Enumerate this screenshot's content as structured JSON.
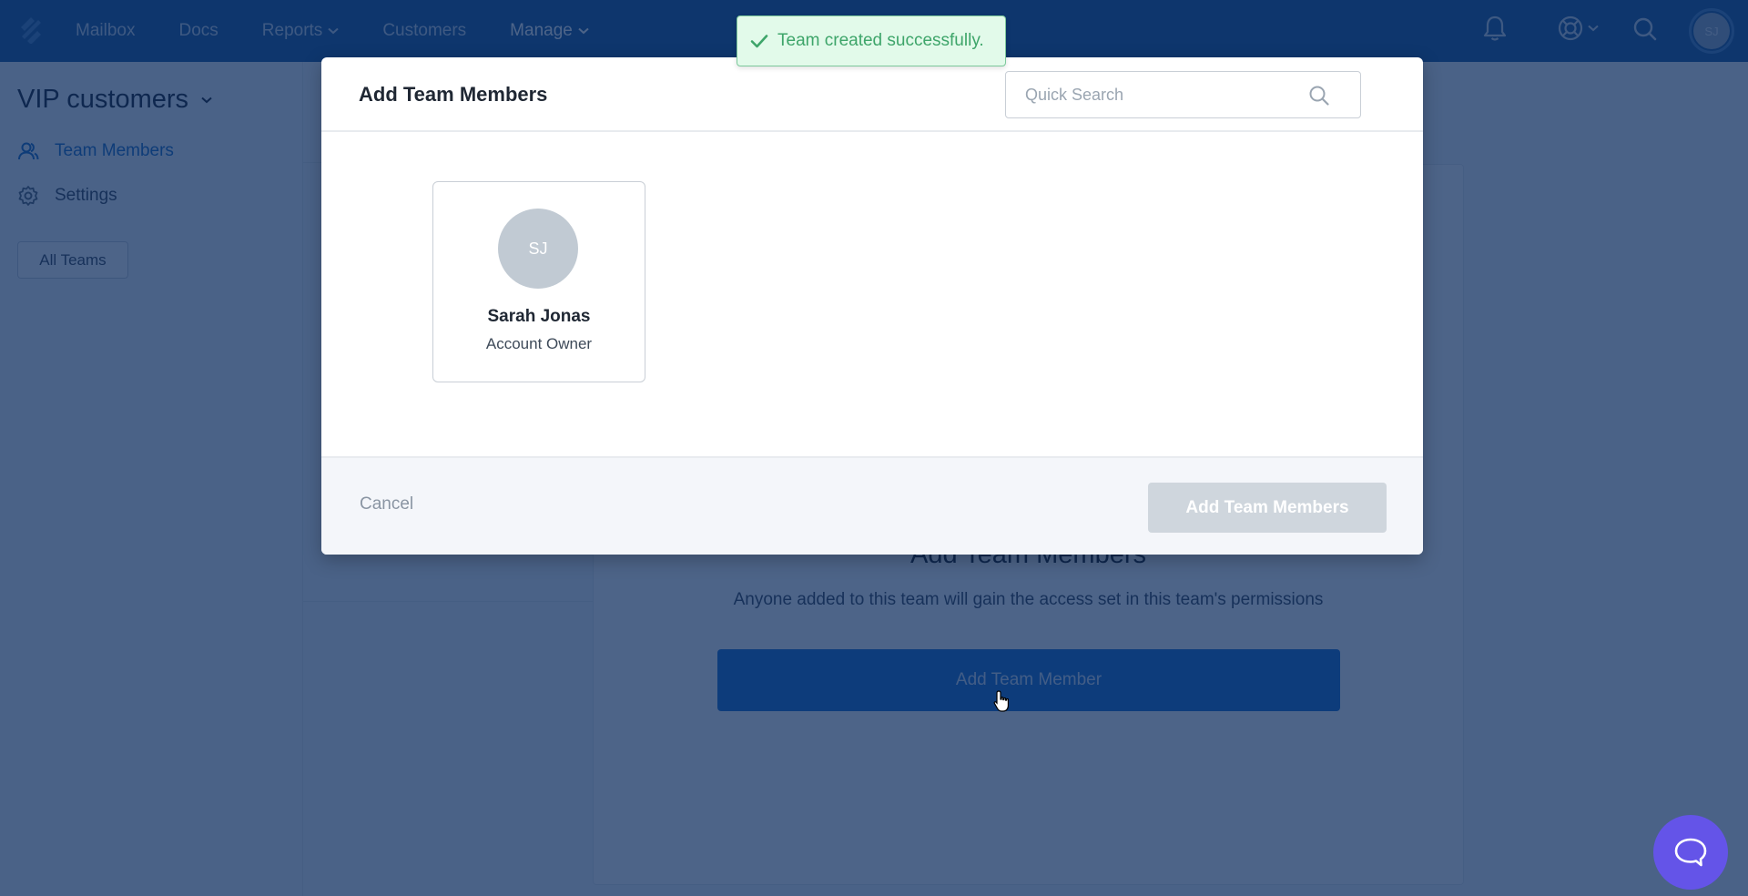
{
  "topnav": {
    "items": [
      {
        "label": "Mailbox",
        "has_dropdown": false
      },
      {
        "label": "Docs",
        "has_dropdown": false
      },
      {
        "label": "Reports",
        "has_dropdown": true
      },
      {
        "label": "Customers",
        "has_dropdown": false
      },
      {
        "label": "Manage",
        "has_dropdown": true,
        "active": true
      }
    ],
    "icons": [
      "notification-bell-icon",
      "help-lifebuoy-icon",
      "search-icon"
    ],
    "user_initials": "SJ"
  },
  "sidebar": {
    "team_name": "VIP customers",
    "links": [
      {
        "label": "Team Members",
        "icon": "team-members-icon",
        "active": true
      },
      {
        "label": "Settings",
        "icon": "gear-icon",
        "active": false
      }
    ],
    "all_teams_label": "All Teams"
  },
  "background": {
    "heading": "Add Team Members",
    "description": "Anyone added to this team will gain the access set in this team's permissions",
    "button_label": "Add Team Member"
  },
  "modal": {
    "title": "Add Team Members",
    "search_placeholder": "Quick Search",
    "search_value": "",
    "members": [
      {
        "initials": "SJ",
        "name": "Sarah Jonas",
        "role": "Account Owner"
      }
    ],
    "cancel_label": "Cancel",
    "submit_label": "Add Team Members",
    "submit_disabled": true
  },
  "toast": {
    "message": "Team created successfully.",
    "type": "success"
  },
  "colors": {
    "nav_bg": "#1f5c9e",
    "accent": "#1f6fc7",
    "success": "#3ea56a",
    "beacon": "#6454e8",
    "disabled_button": "#cfd6dd"
  }
}
